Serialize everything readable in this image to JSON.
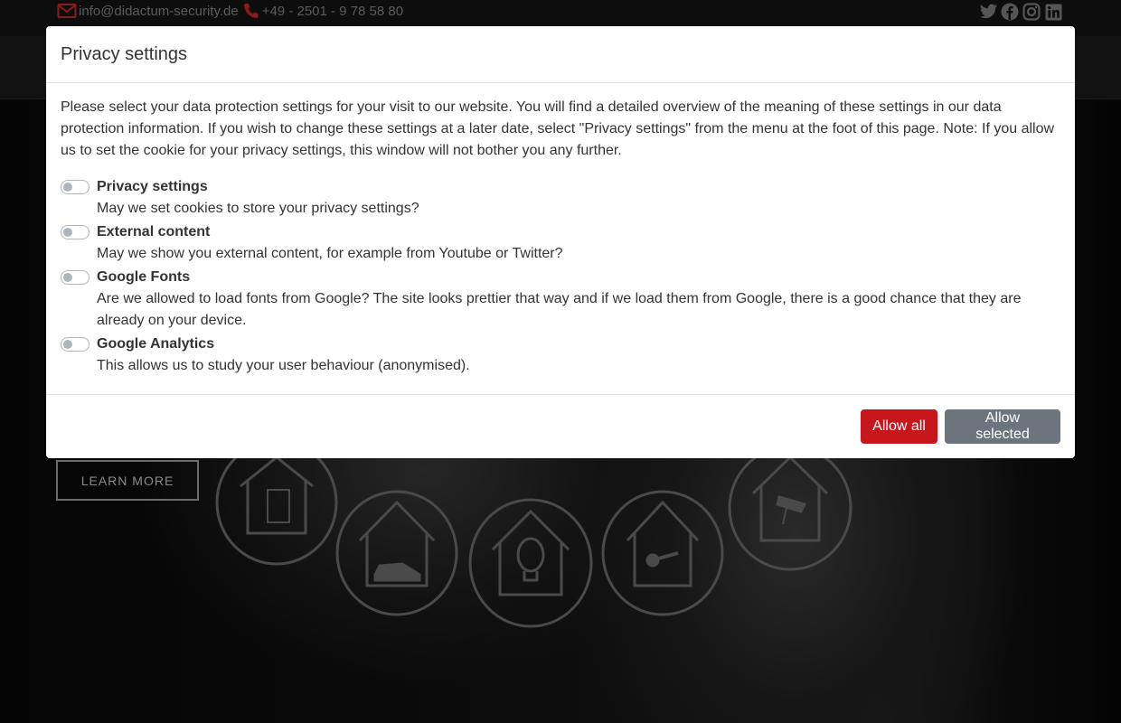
{
  "topbar": {
    "email": "info@didactum-security.de",
    "phone": "+49 - 2501 - 9 78 58 80",
    "email_icon": "mail-icon",
    "phone_icon": "phone-icon",
    "social": [
      {
        "name": "twitter",
        "icon": "twitter-icon"
      },
      {
        "name": "facebook",
        "icon": "facebook-icon"
      },
      {
        "name": "instagram",
        "icon": "instagram-icon"
      },
      {
        "name": "linkedin",
        "icon": "linkedin-icon"
      }
    ],
    "accent_color": "#8b1a1a"
  },
  "hero": {
    "learn_more_label": "LEARN MORE",
    "icons": [
      "house-window-icon",
      "house-car-icon",
      "house-lightbulb-icon",
      "house-key-icon",
      "house-camera-icon"
    ]
  },
  "modal": {
    "title": "Privacy settings",
    "intro": "Please select your data protection settings for your visit to our website. You will find a detailed overview of the meaning of these settings in our data protection information. If you wish to change these settings at a later date, select \"Privacy settings\" from the menu at the foot of this page. Note: If you allow us to set the cookie for your privacy settings, this window will not bother you any further.",
    "options": [
      {
        "title": "Privacy settings",
        "description": "May we set cookies to store your privacy settings?",
        "enabled": false
      },
      {
        "title": "External content",
        "description": "May we show you external content, for example from Youtube or Twitter?",
        "enabled": false
      },
      {
        "title": "Google Fonts",
        "description": "Are we allowed to load fonts from Google? The site looks prettier that way and if we load them from Google, there is a good chance that they are already on your device.",
        "enabled": false
      },
      {
        "title": "Google Analytics",
        "description": "This allows us to study your user behaviour (anonymised).",
        "enabled": false
      }
    ],
    "buttons": {
      "allow_all": "Allow all",
      "allow_selected": "Allow selected"
    },
    "colors": {
      "allow_all": "#c8161d",
      "allow_selected": "#6c757d"
    }
  }
}
